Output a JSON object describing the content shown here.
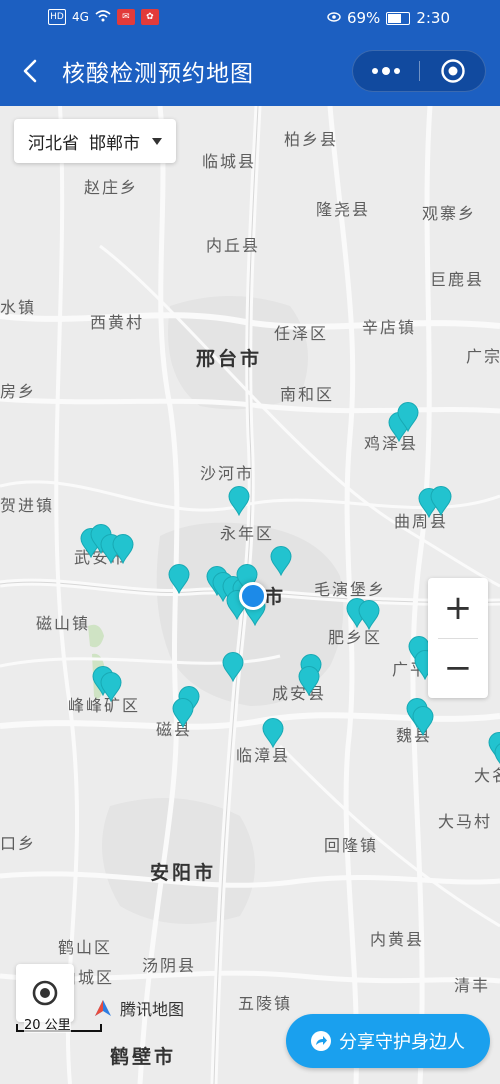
{
  "status_bar": {
    "battery": "69%",
    "time": "2:30",
    "hd": "HD",
    "signal": "4G"
  },
  "navbar": {
    "title": "核酸检测预约地图"
  },
  "region_select": {
    "province": "河北省",
    "city": "邯郸市"
  },
  "map": {
    "labels": [
      {
        "text": "柏乡县",
        "type": "town"
      },
      {
        "text": "临城县",
        "type": "town"
      },
      {
        "text": "赵庄乡",
        "type": "town"
      },
      {
        "text": "隆尧县",
        "type": "town"
      },
      {
        "text": "观寨乡",
        "type": "town"
      },
      {
        "text": "内丘县",
        "type": "town"
      },
      {
        "text": "巨鹿县",
        "type": "town"
      },
      {
        "text": "水镇",
        "type": "town"
      },
      {
        "text": "西黄村",
        "type": "town"
      },
      {
        "text": "任泽区",
        "type": "town"
      },
      {
        "text": "辛店镇",
        "type": "town"
      },
      {
        "text": "邢台市",
        "type": "city"
      },
      {
        "text": "广宗",
        "type": "town"
      },
      {
        "text": "房乡",
        "type": "town"
      },
      {
        "text": "南和区",
        "type": "town"
      },
      {
        "text": "鸡泽县",
        "type": "town"
      },
      {
        "text": "沙河市",
        "type": "town"
      },
      {
        "text": "贺进镇",
        "type": "town"
      },
      {
        "text": "永年区",
        "type": "town"
      },
      {
        "text": "曲周县",
        "type": "town"
      },
      {
        "text": "武安市",
        "type": "town"
      },
      {
        "text": "市",
        "type": "city"
      },
      {
        "text": "毛演堡乡",
        "type": "town"
      },
      {
        "text": "磁山镇",
        "type": "town"
      },
      {
        "text": "肥乡区",
        "type": "town"
      },
      {
        "text": "广平",
        "type": "town"
      },
      {
        "text": "峰峰矿区",
        "type": "town"
      },
      {
        "text": "成安县",
        "type": "town"
      },
      {
        "text": "磁县",
        "type": "town"
      },
      {
        "text": "临漳县",
        "type": "town"
      },
      {
        "text": "魏县",
        "type": "town"
      },
      {
        "text": "大名",
        "type": "town"
      },
      {
        "text": "口乡",
        "type": "town"
      },
      {
        "text": "大马村",
        "type": "town"
      },
      {
        "text": "回隆镇",
        "type": "town"
      },
      {
        "text": "安阳市",
        "type": "city"
      },
      {
        "text": "鹤山区",
        "type": "town"
      },
      {
        "text": "内黄县",
        "type": "town"
      },
      {
        "text": "山城区",
        "type": "town"
      },
      {
        "text": "汤阴县",
        "type": "town"
      },
      {
        "text": "清丰",
        "type": "town"
      },
      {
        "text": "五陵镇",
        "type": "town"
      },
      {
        "text": "鹤壁市",
        "type": "city"
      }
    ]
  },
  "zoom": {
    "in": "+",
    "out": "−"
  },
  "provider": "腾讯地图",
  "scale": "20 公里",
  "share_button": "分享守护身边人"
}
